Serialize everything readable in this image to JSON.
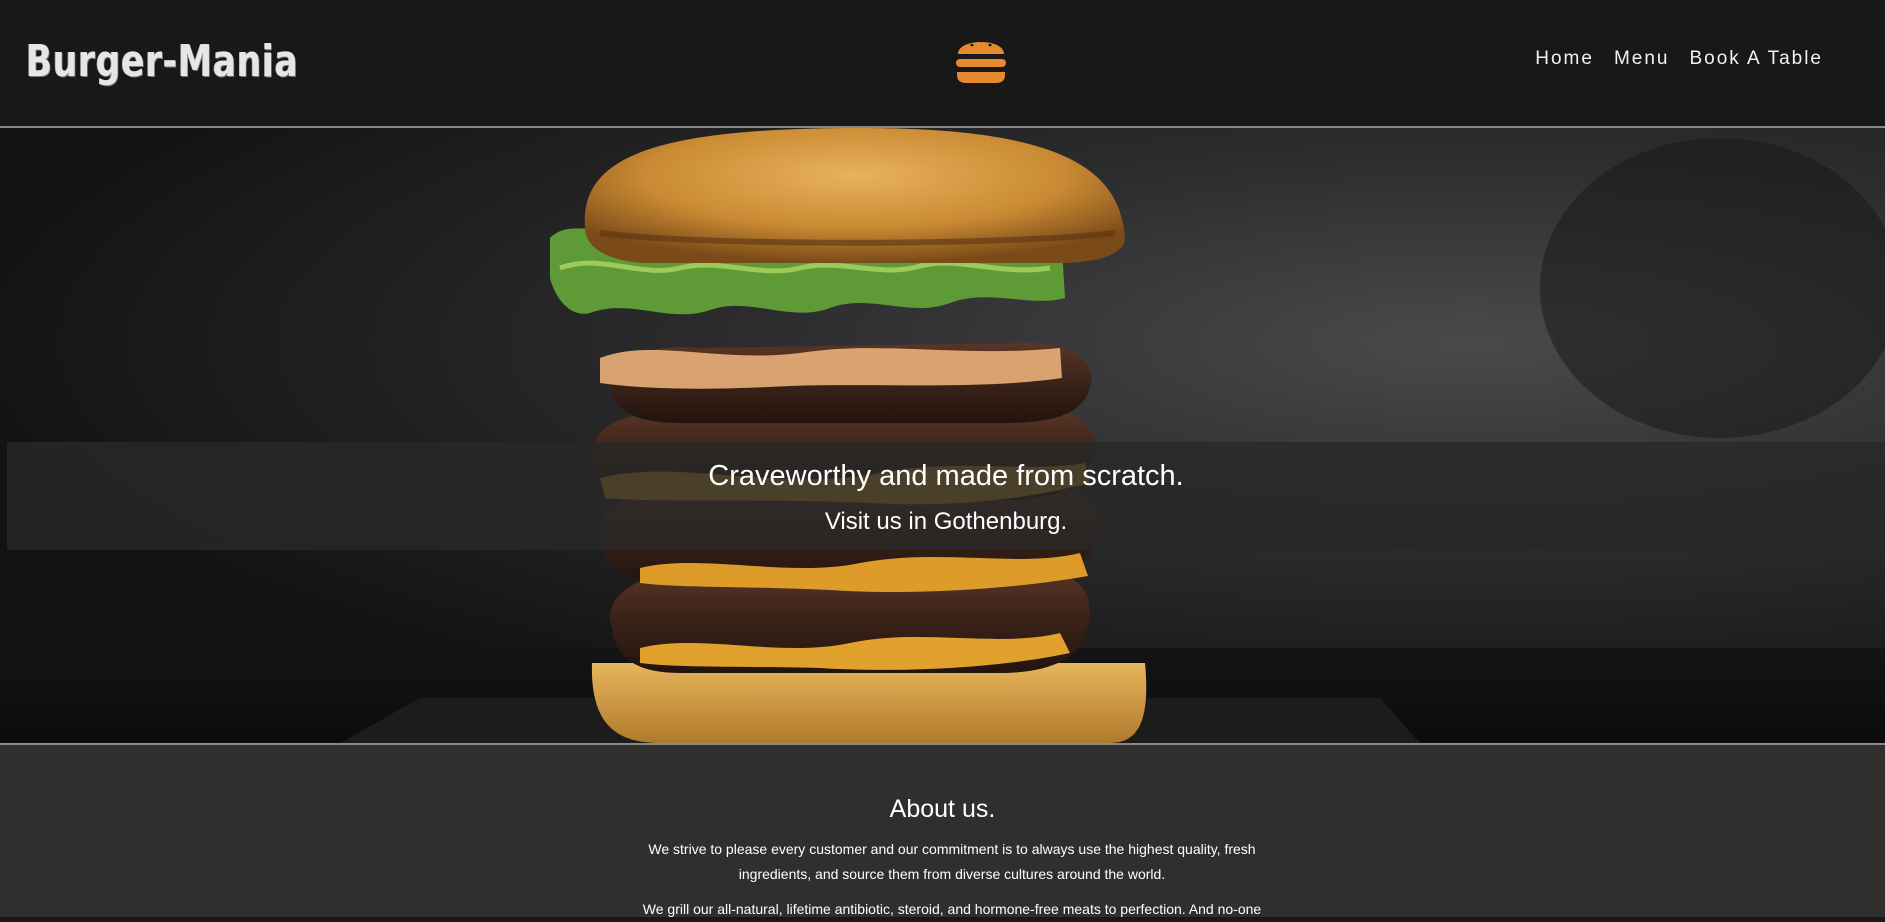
{
  "header": {
    "logo": "Burger-Mania",
    "icon": "burger-icon",
    "nav": [
      {
        "label": "Home"
      },
      {
        "label": "Menu"
      },
      {
        "label": "Book A Table"
      }
    ]
  },
  "hero": {
    "title": "Craveworthy and made from scratch.",
    "subtitle": "Visit us in Gothenburg."
  },
  "about": {
    "title": "About us.",
    "p1": "We strive to please every customer and our commitment is to always use the highest quality, fresh ingredients, and source them from diverse cultures around the world.",
    "p2": "We grill our all-natural, lifetime antibiotic, steroid, and hormone-free meats to perfection. And no-one"
  },
  "colors": {
    "accent": "#e58a2e",
    "header_bg": "#181818",
    "about_bg": "#312e2e"
  }
}
